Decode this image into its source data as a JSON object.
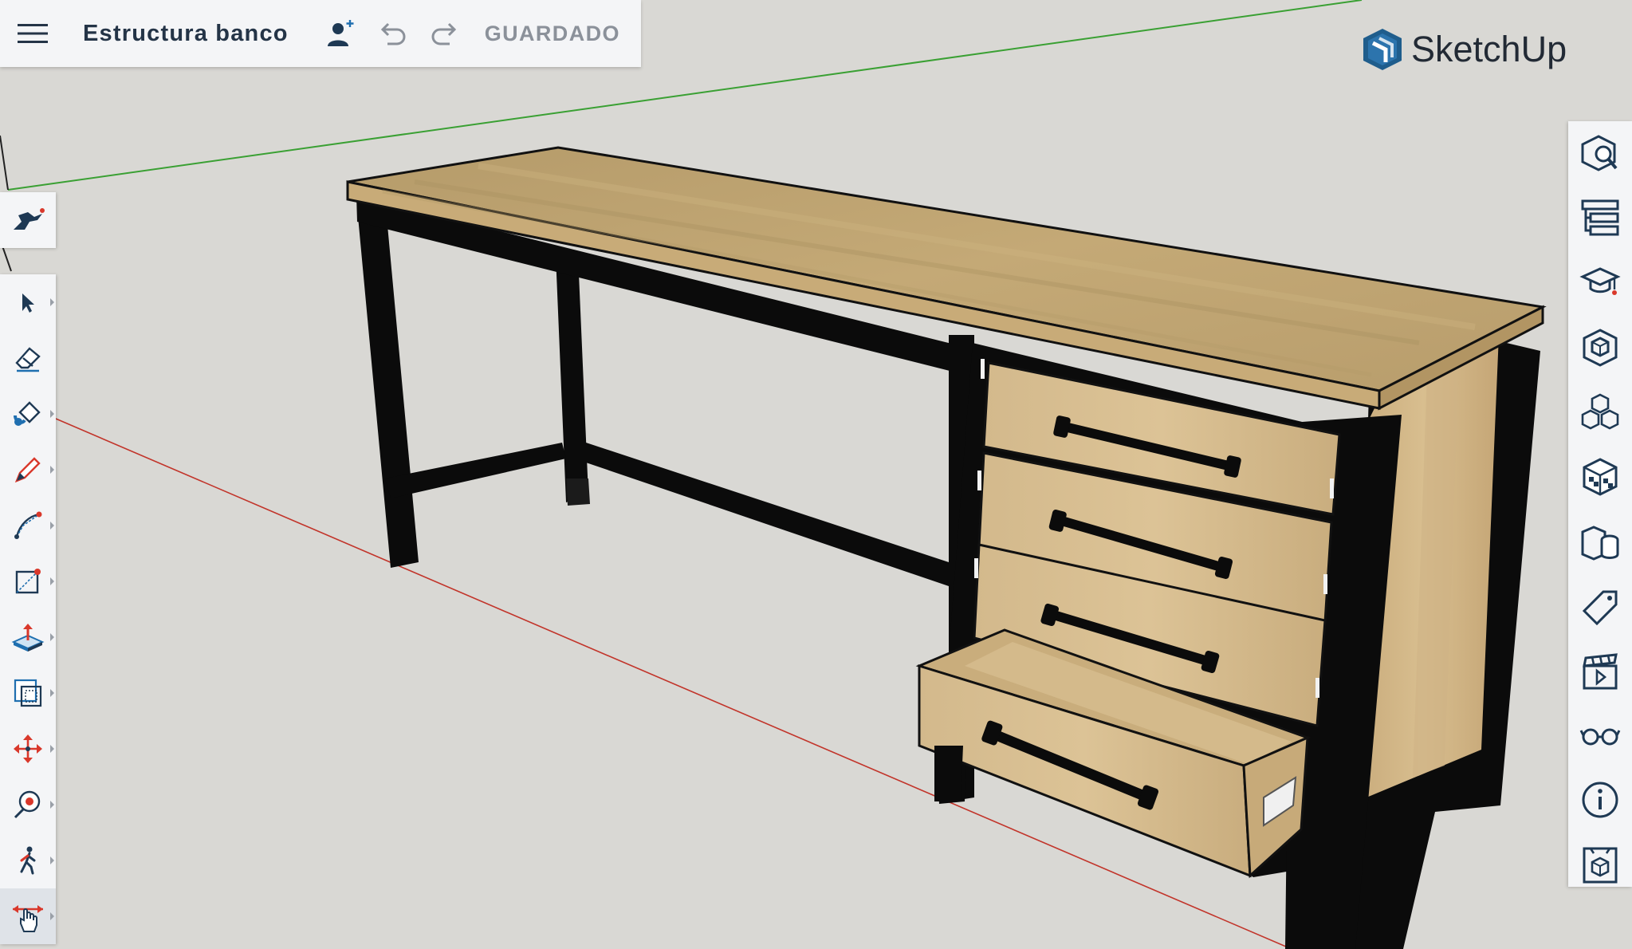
{
  "header": {
    "model_title": "Estructura banco",
    "save_status": "GUARDADO"
  },
  "brand": {
    "name": "SketchUp",
    "color": "#1f5d8c"
  },
  "colors": {
    "accent_red": "#d9382b",
    "axis_red": "#c2342a",
    "axis_green": "#3aa033",
    "icon_dark": "#1e3954",
    "wood": "#c9ac7a",
    "metal": "#111111"
  },
  "left_toolbar": {
    "top_button": "search-tool-icon",
    "tools": [
      {
        "name": "select",
        "icon": "select-arrow-icon"
      },
      {
        "name": "eraser",
        "icon": "eraser-icon"
      },
      {
        "name": "paint",
        "icon": "paint-bucket-icon"
      },
      {
        "name": "line",
        "icon": "pencil-icon"
      },
      {
        "name": "arc",
        "icon": "arc-icon"
      },
      {
        "name": "rectangle",
        "icon": "rectangle-icon"
      },
      {
        "name": "push-pull",
        "icon": "push-pull-icon"
      },
      {
        "name": "offset",
        "icon": "offset-icon"
      },
      {
        "name": "move",
        "icon": "move-icon"
      },
      {
        "name": "tape-measure",
        "icon": "tape-measure-icon"
      },
      {
        "name": "walk",
        "icon": "walk-icon"
      },
      {
        "name": "pan",
        "icon": "pan-hand-icon"
      }
    ]
  },
  "right_panel": {
    "items": [
      {
        "name": "entity-info",
        "icon": "cube-magnifier-icon"
      },
      {
        "name": "outliner",
        "icon": "outliner-icon"
      },
      {
        "name": "instructor",
        "icon": "graduation-cap-icon"
      },
      {
        "name": "components",
        "icon": "component-icon"
      },
      {
        "name": "3d-warehouse",
        "icon": "boxes-icon"
      },
      {
        "name": "materials",
        "icon": "material-cube-icon"
      },
      {
        "name": "solid-tools",
        "icon": "solid-shapes-icon"
      },
      {
        "name": "tags",
        "icon": "tag-icon"
      },
      {
        "name": "scenes",
        "icon": "clapperboard-icon"
      },
      {
        "name": "display",
        "icon": "glasses-icon"
      },
      {
        "name": "info",
        "icon": "info-icon"
      },
      {
        "name": "model-info",
        "icon": "package-icon"
      }
    ]
  }
}
